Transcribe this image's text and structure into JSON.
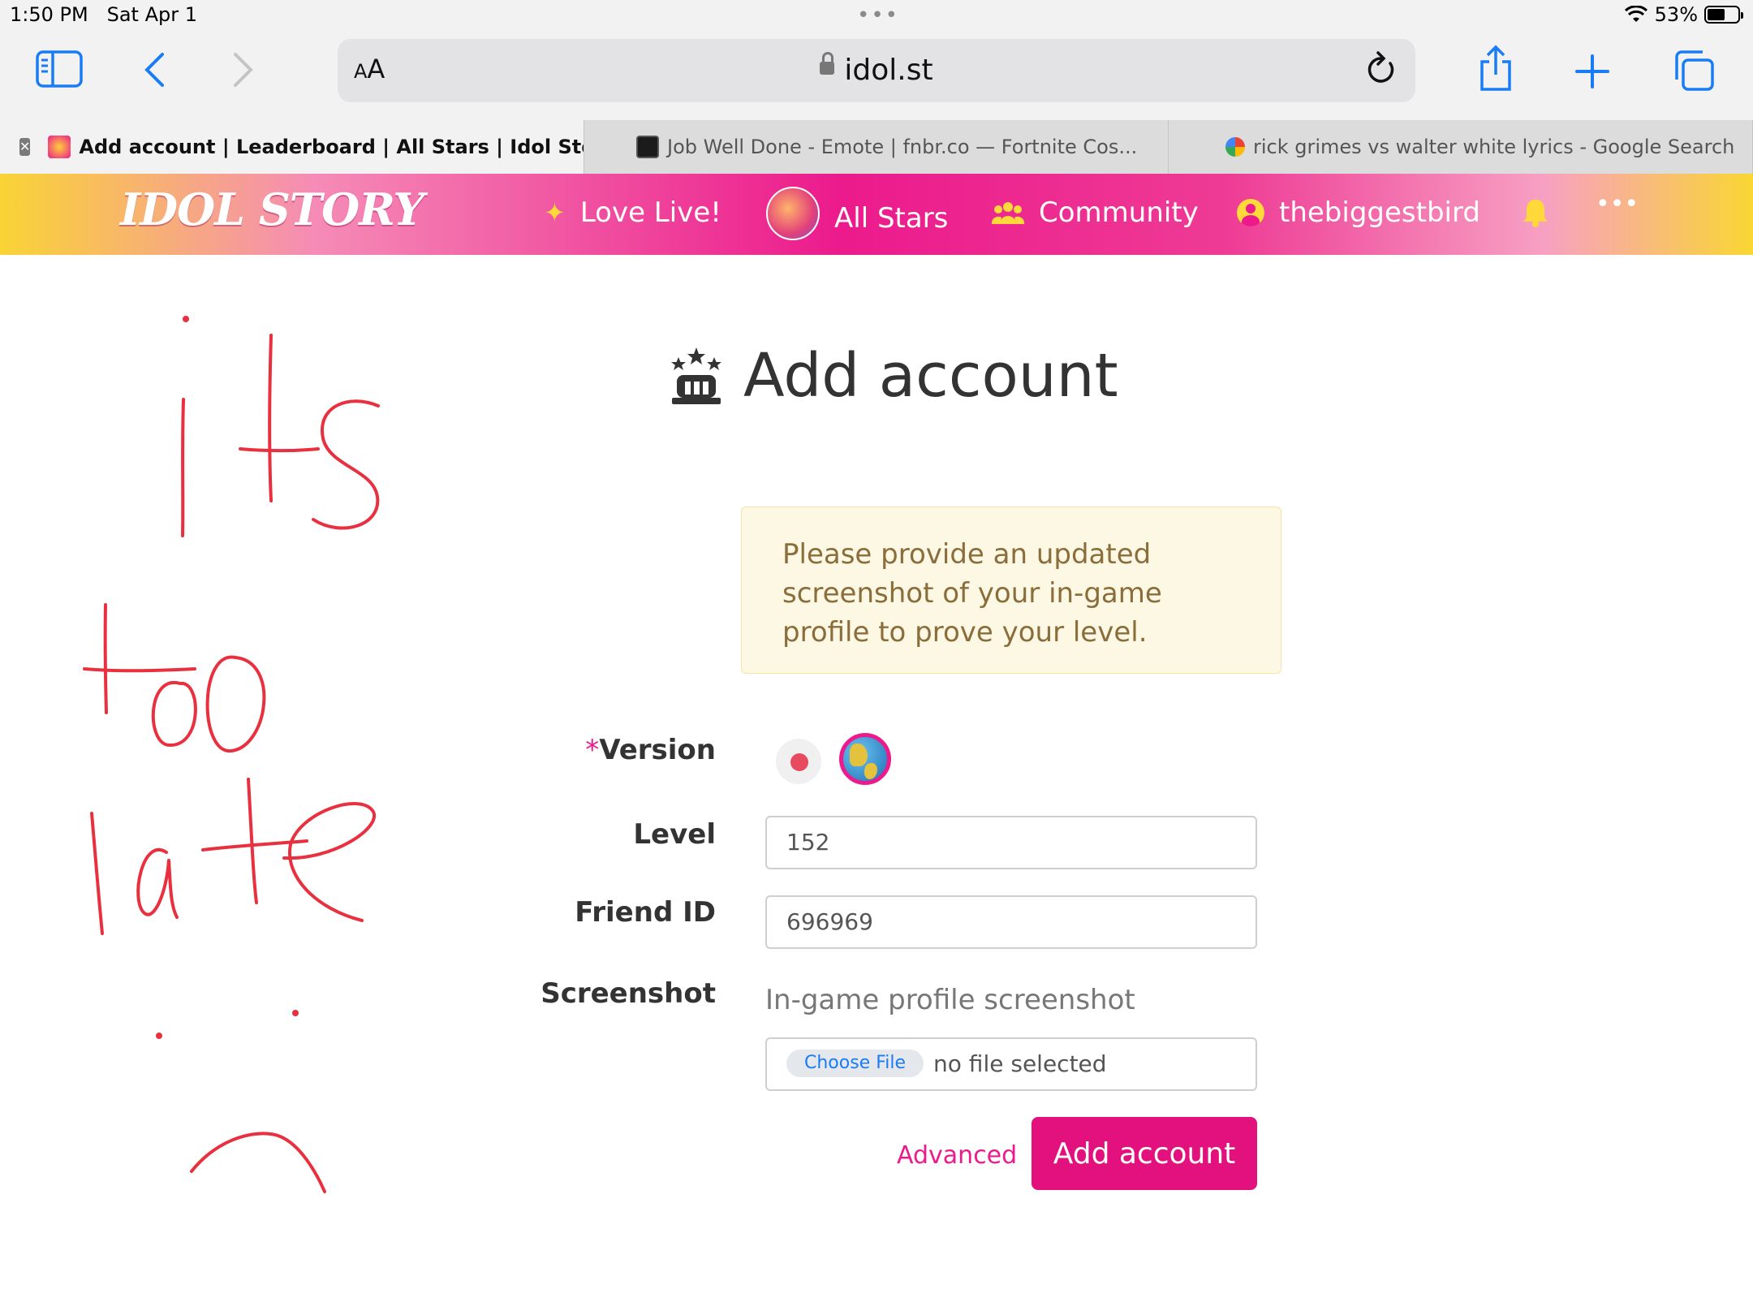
{
  "status_bar": {
    "time": "1:50 PM",
    "date": "Sat Apr 1",
    "battery": "53%",
    "battery_level": 0.53,
    "dots": "•••"
  },
  "browser": {
    "address_aa": "AA",
    "url": "idol.st",
    "tabs": [
      {
        "title": "Add account | Leaderboard | All Stars | Idol Stor...",
        "active": true
      },
      {
        "title": "Job Well Done - Emote | fnbr.co — Fortnite Cos...",
        "active": false
      },
      {
        "title": "rick grimes vs walter white lyrics - Google Search",
        "active": false
      }
    ],
    "tab_close": "✕"
  },
  "site": {
    "logo": "IDOL STORY",
    "nav": {
      "love_live": "Love Live!",
      "all_stars": "All Stars",
      "community": "Community",
      "user": "thebiggestbird",
      "more": "•••"
    }
  },
  "main": {
    "title": "Add account",
    "alert": "Please provide an updated screenshot of your in-game profile to prove your level.",
    "version_required_mark": "*",
    "labels": {
      "version": "Version",
      "level": "Level",
      "friend_id": "Friend ID",
      "screenshot": "Screenshot"
    },
    "level_value": "152",
    "friend_id_value": "696969",
    "screenshot_hint": "In-game profile screenshot",
    "choose_file": "Choose File",
    "no_file": "no file selected",
    "advanced": "Advanced",
    "submit": "Add account"
  },
  "colors": {
    "brand_pink": "#ec1a8c",
    "button_pink": "#e3117e",
    "yellow": "#ffd93a",
    "ios_blue": "#1a7cf5",
    "scribble_red": "#e8303f"
  },
  "annotation": {
    "handwritten_text": "its too late"
  }
}
